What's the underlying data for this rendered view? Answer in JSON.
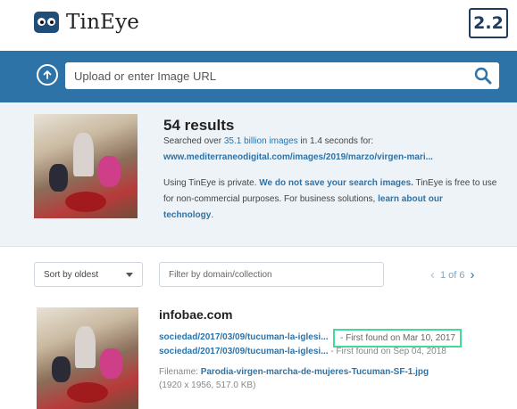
{
  "brand": {
    "name": "TinEye",
    "badge": "2.2"
  },
  "search": {
    "placeholder": "Upload or enter Image URL"
  },
  "summary": {
    "count": "54 results",
    "searched_prefix": "Searched over ",
    "searched_count": "35.1 billion images",
    "searched_suffix": " in 1.4 seconds for:",
    "url": "www.mediterraneodigital.com/images/2019/marzo/virgen-mari...",
    "privacy_prefix": "Using TinEye is private. ",
    "privacy_link": "We do not save your search images.",
    "privacy_suffix": " TinEye is free to use",
    "privacy_line2": "for non-commercial purposes. For business solutions, ",
    "privacy_link2": "learn about our",
    "privacy_line3_link": "technology",
    "privacy_line3_end": "."
  },
  "controls": {
    "sort": "Sort by oldest",
    "filter_placeholder": "Filter by domain/collection",
    "page_info": "1 of 6"
  },
  "match": {
    "domain": "infobae.com",
    "link1": "sociedad/2017/03/09/tucuman-la-iglesi...",
    "found1": "- First found on Mar 10, 2017",
    "link2": "sociedad/2017/03/09/tucuman-la-iglesi...",
    "found2": "- First found on Sep 04, 2018",
    "filename_label": "Filename: ",
    "filename": "Parodia-virgen-marcha-de-mujeres-Tucuman-SF-1.jpg",
    "dims": "(1920 x 1956, 517.0 KB)"
  }
}
